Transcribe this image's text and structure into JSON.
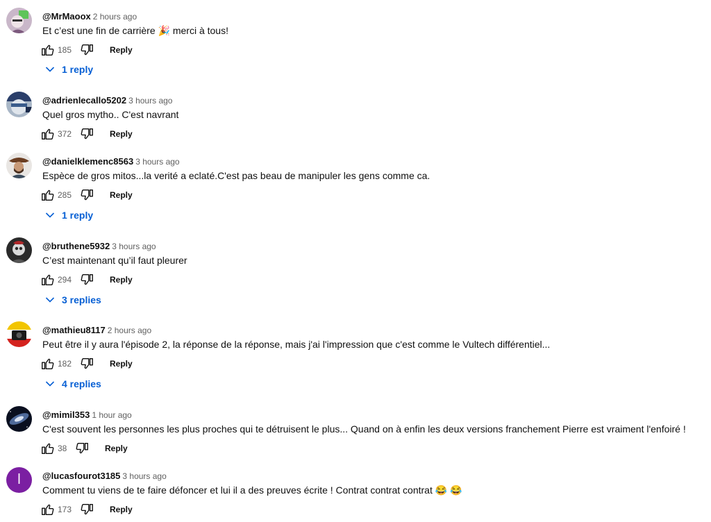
{
  "labels": {
    "reply": "Reply"
  },
  "comments": [
    {
      "author": "@MrMaoox",
      "time": "2 hours ago",
      "text": "Et c’est une fin de carrière 🎉 merci à tous!",
      "likes": "185",
      "replies": "1 reply"
    },
    {
      "author": "@adrienlecallo5202",
      "time": "3 hours ago",
      "text": "Quel gros mytho.. C'est navrant",
      "likes": "372"
    },
    {
      "author": "@danielklemenc8563",
      "time": "3 hours ago",
      "text": "Espèce de gros mitos...la verité a eclaté.C'est pas beau de manipuler les gens comme ca.",
      "likes": "285",
      "replies": "1 reply"
    },
    {
      "author": "@bruthene5932",
      "time": "3 hours ago",
      "text": "C’est maintenant qu’il faut pleurer",
      "likes": "294",
      "replies": "3 replies"
    },
    {
      "author": "@mathieu8117",
      "time": "2 hours ago",
      "text": "Peut être il y aura l'épisode 2, la réponse de la réponse, mais j'ai l'impression que c'est comme le Vultech différentiel...",
      "likes": "182",
      "replies": "4 replies"
    },
    {
      "author": "@mimil353",
      "time": "1 hour ago",
      "text": "C'est souvent les personnes les plus proches qui te détruisent le plus... Quand on à enfin les deux versions franchement Pierre est vraiment l'enfoiré !",
      "likes": "38"
    },
    {
      "author": "@lucasfourot3185",
      "time": "3 hours ago",
      "text": "Comment tu viens de te faire défoncer et lui il a des preuves écrite ! Contrat contrat contrat 😂 😂",
      "likes": "173",
      "avatar_letter": "l"
    }
  ],
  "icons": {
    "like": "thumbs-up-outline-icon",
    "dislike": "thumbs-down-outline-icon",
    "expand": "chevron-down-icon"
  },
  "colors": {
    "link": "#065fd4",
    "meta": "#606060",
    "text": "#0f0f0f",
    "letter_avatar": "#7b1fa2"
  }
}
